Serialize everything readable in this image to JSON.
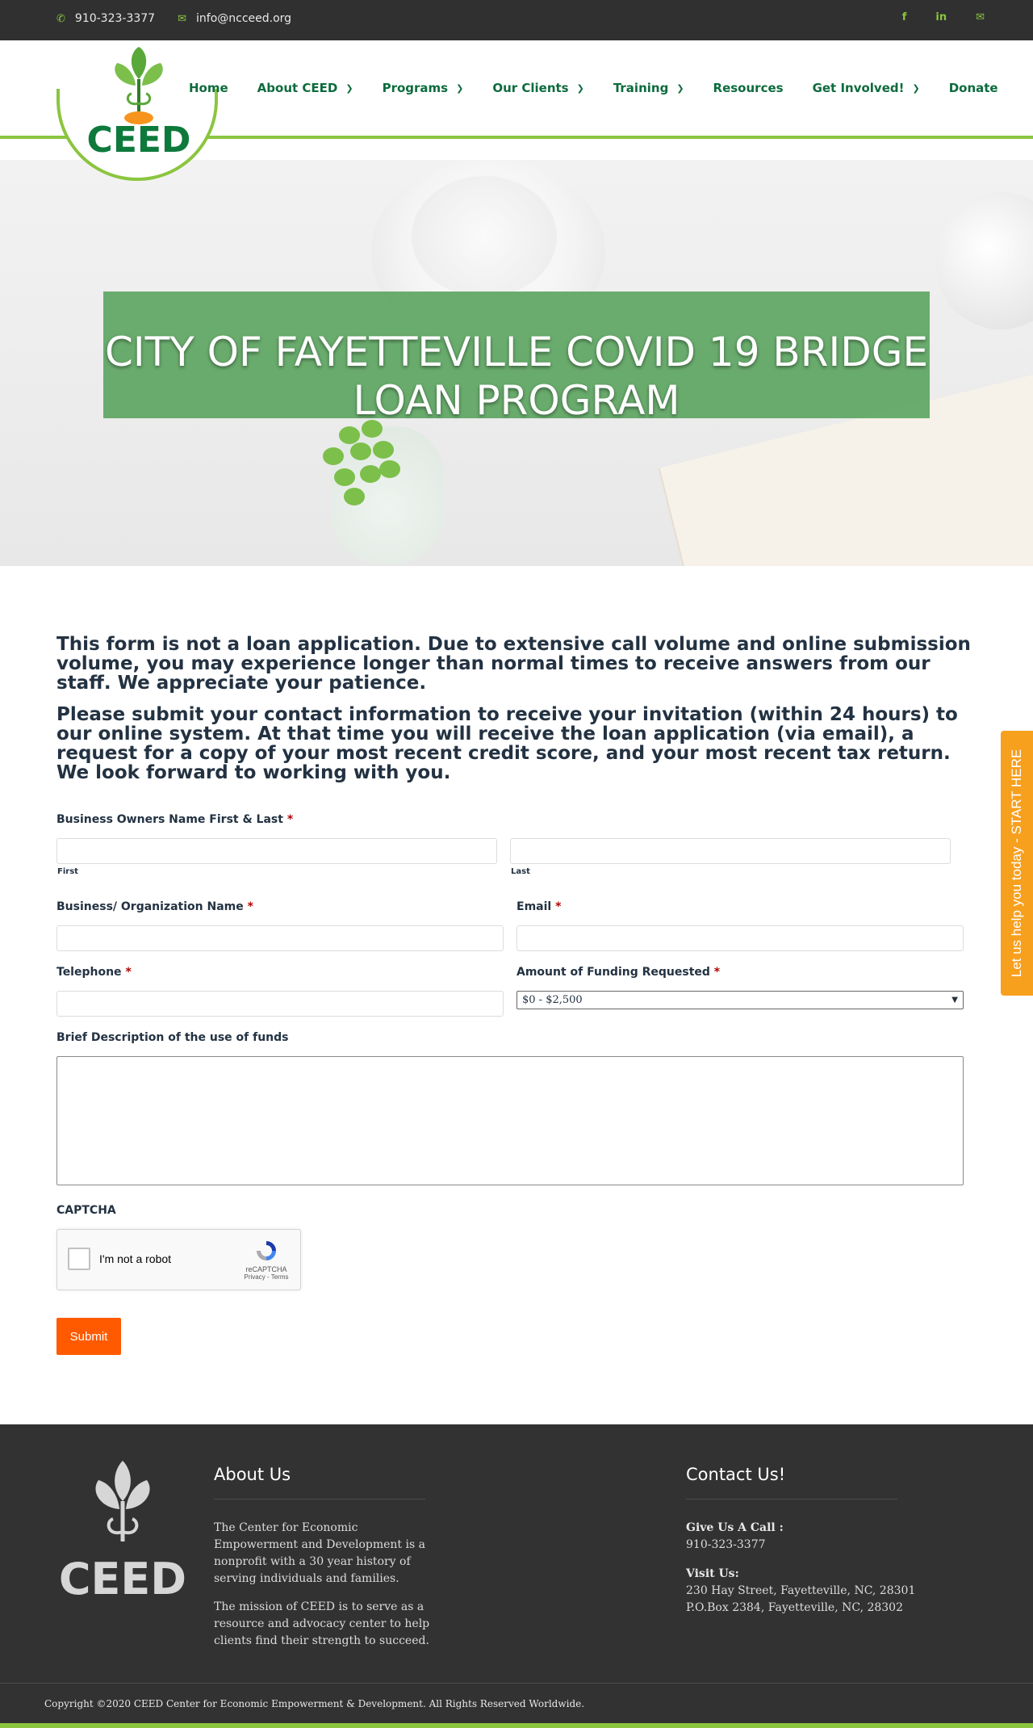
{
  "topbar": {
    "phone": "910-323-3377",
    "email": "info@ncceed.org",
    "social": [
      "f",
      "in",
      "✉"
    ]
  },
  "brand": {
    "logo_text": "CEED"
  },
  "nav": [
    {
      "label": "Home",
      "has_dropdown": false
    },
    {
      "label": "About CEED",
      "has_dropdown": true
    },
    {
      "label": "Programs",
      "has_dropdown": true
    },
    {
      "label": "Our Clients",
      "has_dropdown": true
    },
    {
      "label": "Training",
      "has_dropdown": true
    },
    {
      "label": "Resources",
      "has_dropdown": false
    },
    {
      "label": "Get Involved!",
      "has_dropdown": true
    },
    {
      "label": "Donate",
      "has_dropdown": false
    }
  ],
  "hero": {
    "title": "CITY OF FAYETTEVILLE COVID 19 BRIDGE LOAN PROGRAM"
  },
  "intro": {
    "p1": "This form is not a loan application. Due to extensive call volume and online submission volume, you may experience longer than normal times to receive answers from our staff. We appreciate your patience.",
    "p2": "Please submit your contact information to receive your invitation (within 24 hours) to our online system. At that time you will receive the loan application (via email), a request for a copy of your most recent credit score, and your most recent tax return. We look forward to working with you."
  },
  "form": {
    "owner_label": "Business Owners Name First & Last",
    "first_sublabel": "First",
    "last_sublabel": "Last",
    "business_label": "Business/ Organization Name",
    "email_label": "Email",
    "telephone_label": "Telephone",
    "funding_label": "Amount of Funding Requested",
    "funding_selected": "$0 - $2,500",
    "description_label": "Brief Description of the use of funds",
    "captcha_label": "CAPTCHA",
    "captcha_text": "I'm not a robot",
    "captcha_brand": "reCAPTCHA",
    "captcha_links": "Privacy - Terms",
    "submit_label": "Submit",
    "required_mark": "*"
  },
  "sidetab": {
    "label": "Let us help you today - START HERE"
  },
  "footer": {
    "about_title": "About Us",
    "about_p1": "The Center for Economic Empowerment and Development is a nonprofit with a 30 year history of serving individuals and families.",
    "about_p2": "The mission of CEED is to serve as a resource and advocacy center to help clients find their strength to succeed.",
    "contact_title": "Contact Us!",
    "call_label": "Give Us A Call :",
    "call_value": "910-323-3377",
    "visit_label": "Visit Us:",
    "address1": "230 Hay Street, Fayetteville, NC, 28301",
    "address2": "P.O.Box 2384, Fayetteville, NC, 28302",
    "copyright": "Copyright ©2020 CEED Center for Economic Empowerment & Development. All Rights Reserved Worldwide."
  },
  "colors": {
    "accent_green": "#8bc53f",
    "nav_green": "#0d6b3d",
    "submit_orange": "#ff5a00",
    "sidetab_orange": "#f7a01e",
    "dark_bg": "#323232"
  }
}
